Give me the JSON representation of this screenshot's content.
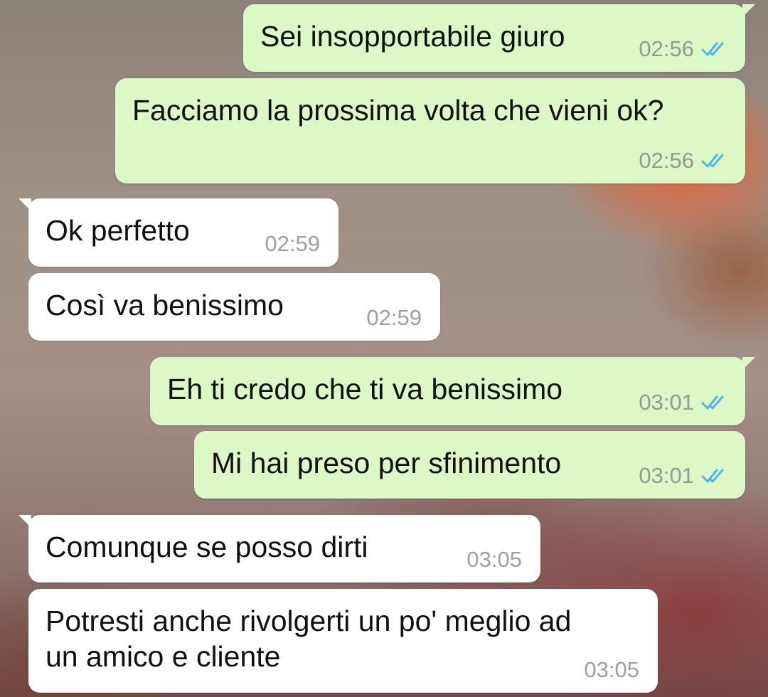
{
  "conversation": {
    "messages": [
      {
        "direction": "outgoing",
        "text": "Sei insopportabile giuro",
        "time": "02:56",
        "status_icon": "double-check-read-icon"
      },
      {
        "direction": "outgoing",
        "text": "Facciamo la prossima volta che vieni ok?",
        "time": "02:56",
        "status_icon": "double-check-read-icon"
      },
      {
        "direction": "incoming",
        "text": "Ok perfetto",
        "time": "02:59"
      },
      {
        "direction": "incoming",
        "text": "Così va benissimo",
        "time": "02:59"
      },
      {
        "direction": "outgoing",
        "text": "Eh ti credo che ti va benissimo",
        "time": "03:01",
        "status_icon": "double-check-read-icon"
      },
      {
        "direction": "outgoing",
        "text": "Mi hai preso per sfinimento",
        "time": "03:01",
        "status_icon": "double-check-read-icon"
      },
      {
        "direction": "incoming",
        "text": "Comunque se posso dirti",
        "time": "03:05"
      },
      {
        "direction": "incoming",
        "text": "Potresti anche rivolgerti un po' meglio ad\nun amico e cliente",
        "time": "03:05"
      }
    ]
  },
  "colors": {
    "outgoing_bubble": "#dcf8c6",
    "incoming_bubble": "#ffffff",
    "read_ticks": "#4fb6ec",
    "timestamp": "#8f9b93"
  }
}
